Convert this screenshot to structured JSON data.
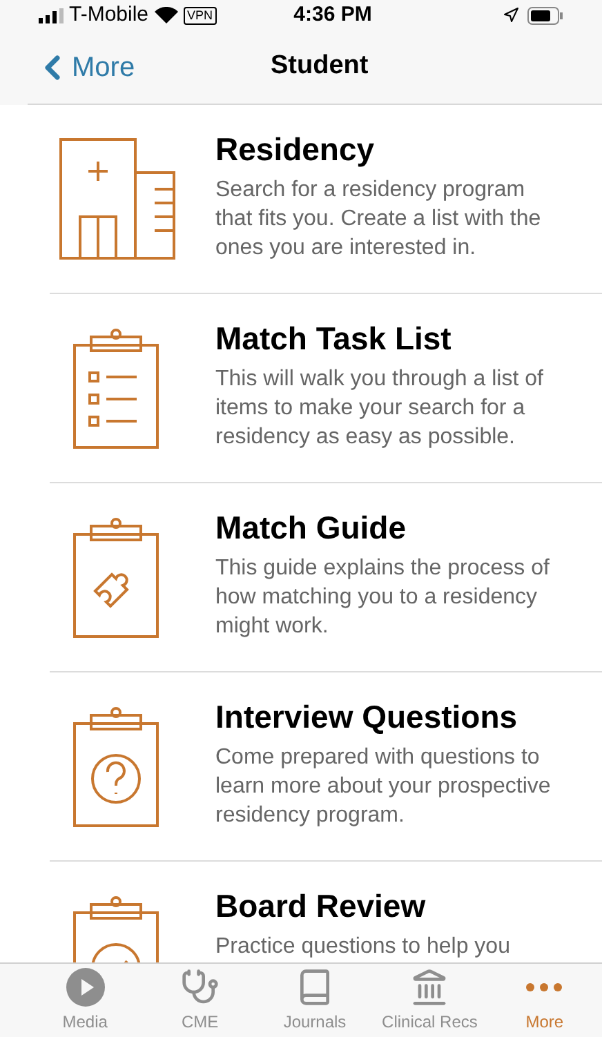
{
  "status_bar": {
    "carrier": "T-Mobile",
    "vpn": "VPN",
    "time": "4:36 PM"
  },
  "nav": {
    "back": "More",
    "title": "Student"
  },
  "items": [
    {
      "kind": "building",
      "title": "Residency",
      "description": "Search for a residency program that fits you. Create a list with the ones you are interested in."
    },
    {
      "kind": "checklist",
      "title": "Match Task List",
      "description": "This will walk you through a list of items to make your search for a residency as easy as possible."
    },
    {
      "kind": "puzzle",
      "title": "Match Guide",
      "description": "This guide explains the process of how matching you to a residency might work."
    },
    {
      "kind": "question",
      "title": "Interview Questions",
      "description": "Come prepared with questions to learn more about your prospective residency program."
    },
    {
      "kind": "check",
      "title": "Board Review",
      "description": "Practice questions to help you"
    }
  ],
  "tabs": [
    {
      "kind": "media",
      "label": "Media",
      "selected": false
    },
    {
      "kind": "cme",
      "label": "CME",
      "selected": false
    },
    {
      "kind": "journals",
      "label": "Journals",
      "selected": false
    },
    {
      "kind": "clinical",
      "label": "Clinical Recs",
      "selected": false
    },
    {
      "kind": "more",
      "label": "More",
      "selected": true
    }
  ]
}
